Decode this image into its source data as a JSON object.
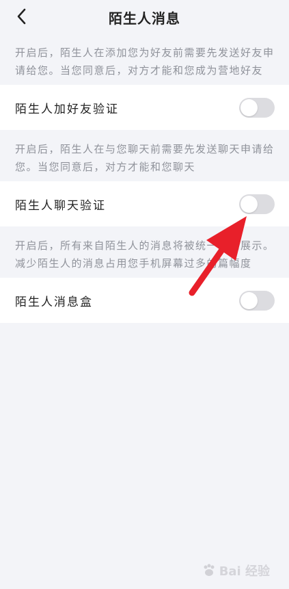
{
  "header": {
    "title": "陌生人消息"
  },
  "sections": [
    {
      "description": "开启后，陌生人在添加您为好友前需要先发送好友申请给您。当您同意后，对方才能和您成为营地好友",
      "label": "陌生人加好友验证",
      "enabled": false
    },
    {
      "description": "开启后，陌生人在与您聊天前需要先发送聊天申请给您。当您同意后，对方才能和您聊天",
      "label": "陌生人聊天验证",
      "enabled": false
    },
    {
      "description": "开启后，所有来自陌生人的消息将被统一收纳展示。减少陌生人的消息占用您手机屏幕过多的篇幅度",
      "label": "陌生人消息盒",
      "enabled": false
    }
  ],
  "watermark": {
    "text": "Bai  经验"
  },
  "colors": {
    "background": "#f3f4f8",
    "toggle_off": "#dcdce0",
    "annotation_arrow": "#e8202a",
    "description_text": "#8f929a"
  },
  "icons": {
    "back": "chevron-left-icon",
    "annotation": "arrow-annotation-icon",
    "watermark": "paw-icon"
  }
}
